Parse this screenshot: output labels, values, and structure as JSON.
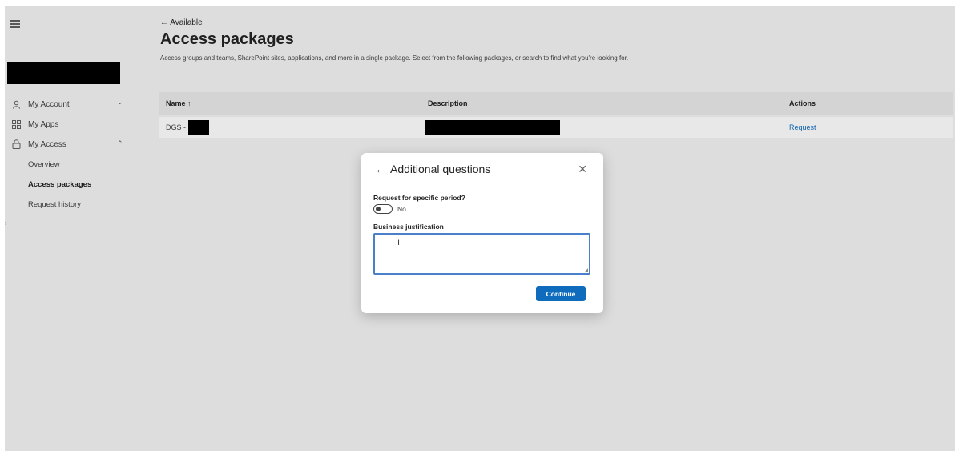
{
  "sidebar": {
    "items": [
      {
        "label": "My Account",
        "icon": "person-icon",
        "chevron": "⌄"
      },
      {
        "label": "My Apps",
        "icon": "apps-grid-icon"
      },
      {
        "label": "My Access",
        "icon": "lock-icon",
        "chevron": "⌃"
      }
    ],
    "sub_items": [
      {
        "label": "Overview"
      },
      {
        "label": "Access packages"
      },
      {
        "label": "Request history"
      }
    ]
  },
  "header": {
    "back_label": "Available",
    "title": "Access packages",
    "description": "Access groups and teams, SharePoint sites, applications, and more in a single package. Select from the following packages, or search to find what you're looking for."
  },
  "table": {
    "columns": [
      "Name ↑",
      "Description",
      "Actions"
    ],
    "rows": [
      {
        "name": "DGS -",
        "action": "Request"
      }
    ]
  },
  "modal": {
    "title": "Additional questions",
    "question_label": "Request for specific period?",
    "toggle_value": "No",
    "justification_label": "Business justification",
    "justification_value": "",
    "continue_label": "Continue"
  },
  "colors": {
    "accent": "#0f6cbd",
    "background": "#f3f3f3",
    "redaction": "#000000"
  }
}
